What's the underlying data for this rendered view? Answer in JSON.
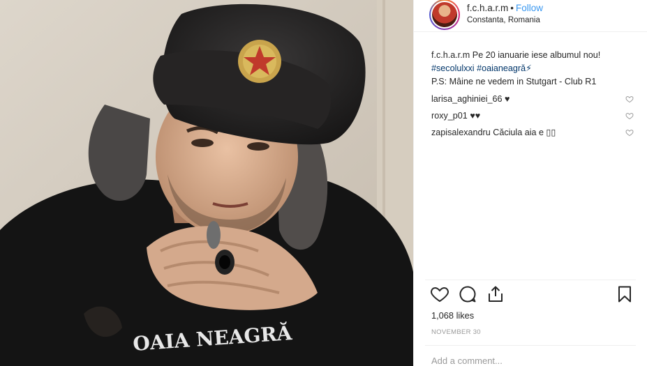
{
  "post": {
    "username": "f.c.h.a.r.m",
    "separator": "•",
    "follow_label": "Follow",
    "location": "Constanta, Romania"
  },
  "caption": {
    "username": "f.c.h.a.r.m",
    "text": "Pe 20 ianuarie iese albumul nou!",
    "hashtag1": "#secolulxxi",
    "hashtag2": "#oaianeagră⚡",
    "ps": "P.S: Mâine ne vedem in Stutgart - Club R1"
  },
  "comments": [
    {
      "user": "larisa_aghiniei_66",
      "text": "♥"
    },
    {
      "user": "roxy_p01",
      "text": "♥♥"
    },
    {
      "user": "zapisalexandru",
      "text": "Căciula aia e ▯▯"
    }
  ],
  "likes": "1,068 likes",
  "date": "NOVEMBER 30",
  "add_comment_placeholder": "Add a comment...",
  "photo": {
    "shirt_text": "OAIA NEAGRĂ"
  },
  "colors": {
    "link": "#3897f0",
    "hashtag": "#003569",
    "muted": "#999999",
    "text": "#262626",
    "border": "#efefef"
  },
  "icons": [
    "heart-icon",
    "comment-icon",
    "share-icon",
    "bookmark-icon"
  ]
}
